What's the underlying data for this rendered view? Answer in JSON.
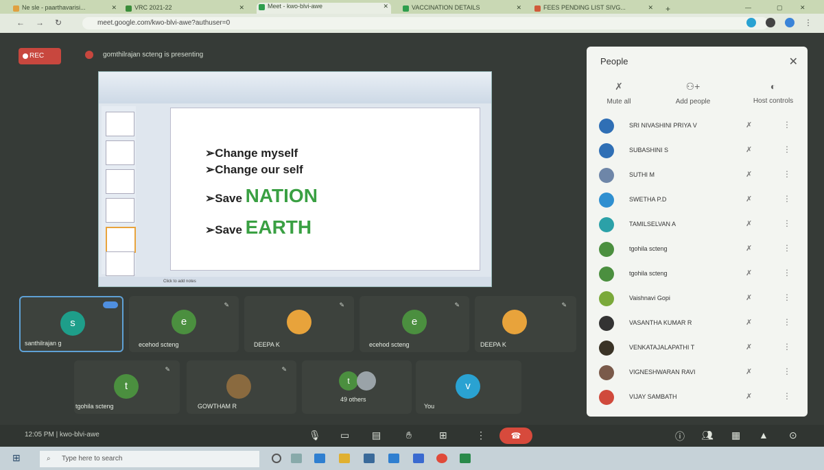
{
  "browser": {
    "tabs": [
      {
        "label": "Ne sle - paarthavarisi...",
        "active": false
      },
      {
        "label": "VRC 2021-22",
        "active": false
      },
      {
        "label": "Meet - kwo-blvi-awe",
        "active": true
      },
      {
        "label": "VACCINATION DETAILS",
        "active": false
      },
      {
        "label": "FEES PENDING LIST SIVG...",
        "active": false
      }
    ],
    "url": "meet.google.com/kwo-blvi-awe?authuser=0"
  },
  "meet": {
    "rec_label": "REC",
    "presenting_text": "gomthilrajan scteng is presenting",
    "meeting_code": "kwo-blvi-awe",
    "time": "12:05 PM"
  },
  "slide": {
    "bullets": [
      {
        "prefix": "➢Change myself",
        "highlight": ""
      },
      {
        "prefix": "➢Change our self",
        "highlight": ""
      },
      {
        "prefix": "➢Save ",
        "highlight": "NATION"
      },
      {
        "prefix": "➢Save ",
        "highlight": "EARTH"
      }
    ],
    "status_text": "Click to add notes"
  },
  "tiles": [
    {
      "name": "santhilrajan g",
      "initial": "s",
      "color": "#1e9e8a"
    },
    {
      "name": "ecehod scteng",
      "initial": "e",
      "color": "#4b8f3f"
    },
    {
      "name": "DEEPA K",
      "initial": "",
      "color": "#e8a33b"
    },
    {
      "name": "ecehod scteng",
      "initial": "e",
      "color": "#4b8f3f"
    },
    {
      "name": "DEEPA K",
      "initial": "",
      "color": "#e8a33b"
    },
    {
      "name": "tgohila scteng",
      "initial": "t",
      "color": "#4b8f3f"
    },
    {
      "name": "GOWTHAM R",
      "initial": "",
      "color": "#8a6a3f"
    },
    {
      "name": "49 others",
      "initial": "t",
      "color": "#4b8f3f"
    },
    {
      "name": "You",
      "initial": "v",
      "color": "#2aa2d2"
    }
  ],
  "people_panel": {
    "title": "People",
    "actions": [
      {
        "label": "Mute all",
        "icon": "mic-off-icon"
      },
      {
        "label": "Add people",
        "icon": "add-person-icon"
      },
      {
        "label": "Host controls",
        "icon": "toggle-icon"
      }
    ],
    "participants": [
      {
        "name": "SRI NIVASHINI PRIYA V",
        "color": "#2f6fb5"
      },
      {
        "name": "SUBASHINI S",
        "color": "#2f6fb5"
      },
      {
        "name": "SUTHI M",
        "color": "#6e86a8"
      },
      {
        "name": "SWETHA P.D",
        "color": "#2f8fd0"
      },
      {
        "name": "TAMILSELVAN A",
        "color": "#2ba1a8"
      },
      {
        "name": "tgohila scteng",
        "color": "#4b8f3f"
      },
      {
        "name": "tgohila scteng",
        "color": "#4b8f3f"
      },
      {
        "name": "Vaishnavi Gopi",
        "color": "#7aa93a"
      },
      {
        "name": "VASANTHA KUMAR R",
        "color": "#333"
      },
      {
        "name": "VENKATAJALAPATHI T",
        "color": "#3a3326"
      },
      {
        "name": "VIGNESHWARAN RAVI",
        "color": "#7a5a4a"
      },
      {
        "name": "VIJAY SAMBATH",
        "color": "#d04a3c"
      }
    ]
  },
  "taskbar": {
    "search_placeholder": "Type here to search"
  }
}
